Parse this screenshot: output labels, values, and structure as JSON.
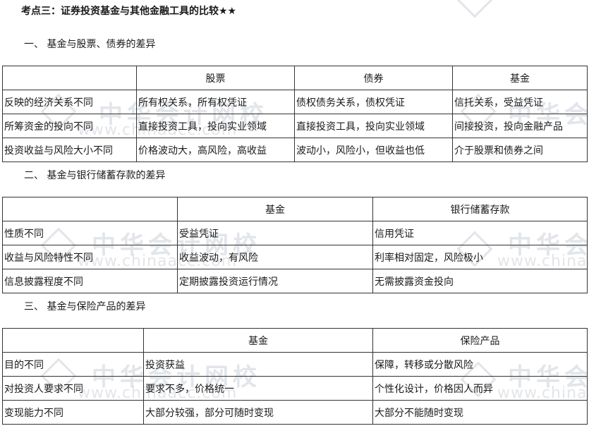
{
  "title": "考点三：证券投资基金与其他金融工具的比较★★",
  "watermark": {
    "cn": "中华会计网校",
    "en": "www.chinaacc.com"
  },
  "sections": [
    {
      "heading": "一、 基金与股票、债券的差异",
      "columns": [
        "",
        "股票",
        "债券",
        "基金"
      ],
      "rows": [
        [
          "反映的经济关系不同",
          "所有权关系，所有权凭证",
          "债权债务关系，债权凭证",
          "信托关系，受益凭证"
        ],
        [
          "所筹资金的投向不同",
          "直接投资工具，投向实业领域",
          "直接投资工具，投向实业领域",
          "间接投资，投向金融产品"
        ],
        [
          "投资收益与风险大小不同",
          "价格波动大，高风险，高收益",
          "波动小，风险小，但收益也低",
          "介于股票和债券之间"
        ]
      ]
    },
    {
      "heading": "二、 基金与银行储蓄存款的差异",
      "columns": [
        "",
        "基金",
        "银行储蓄存款"
      ],
      "rows": [
        [
          "性质不同",
          "受益凭证",
          "信用凭证"
        ],
        [
          "收益与风险特性不同",
          "收益波动，有风险",
          "利率相对固定，风险极小"
        ],
        [
          "信息披露程度不同",
          "定期披露投资运行情况",
          "无需披露资金投向"
        ]
      ]
    },
    {
      "heading": "三、 基金与保险产品的差异",
      "columns": [
        "",
        "基金",
        "保险产品"
      ],
      "rows": [
        [
          "目的不同",
          "投资获益",
          "保障，转移或分散风险"
        ],
        [
          "对投资人要求不同",
          "要求不多，价格统一",
          "个性化设计，价格因人而异"
        ],
        [
          "变现能力不同",
          "大部分较强，部分可随时变现",
          "大部分不能随时变现"
        ]
      ]
    }
  ]
}
